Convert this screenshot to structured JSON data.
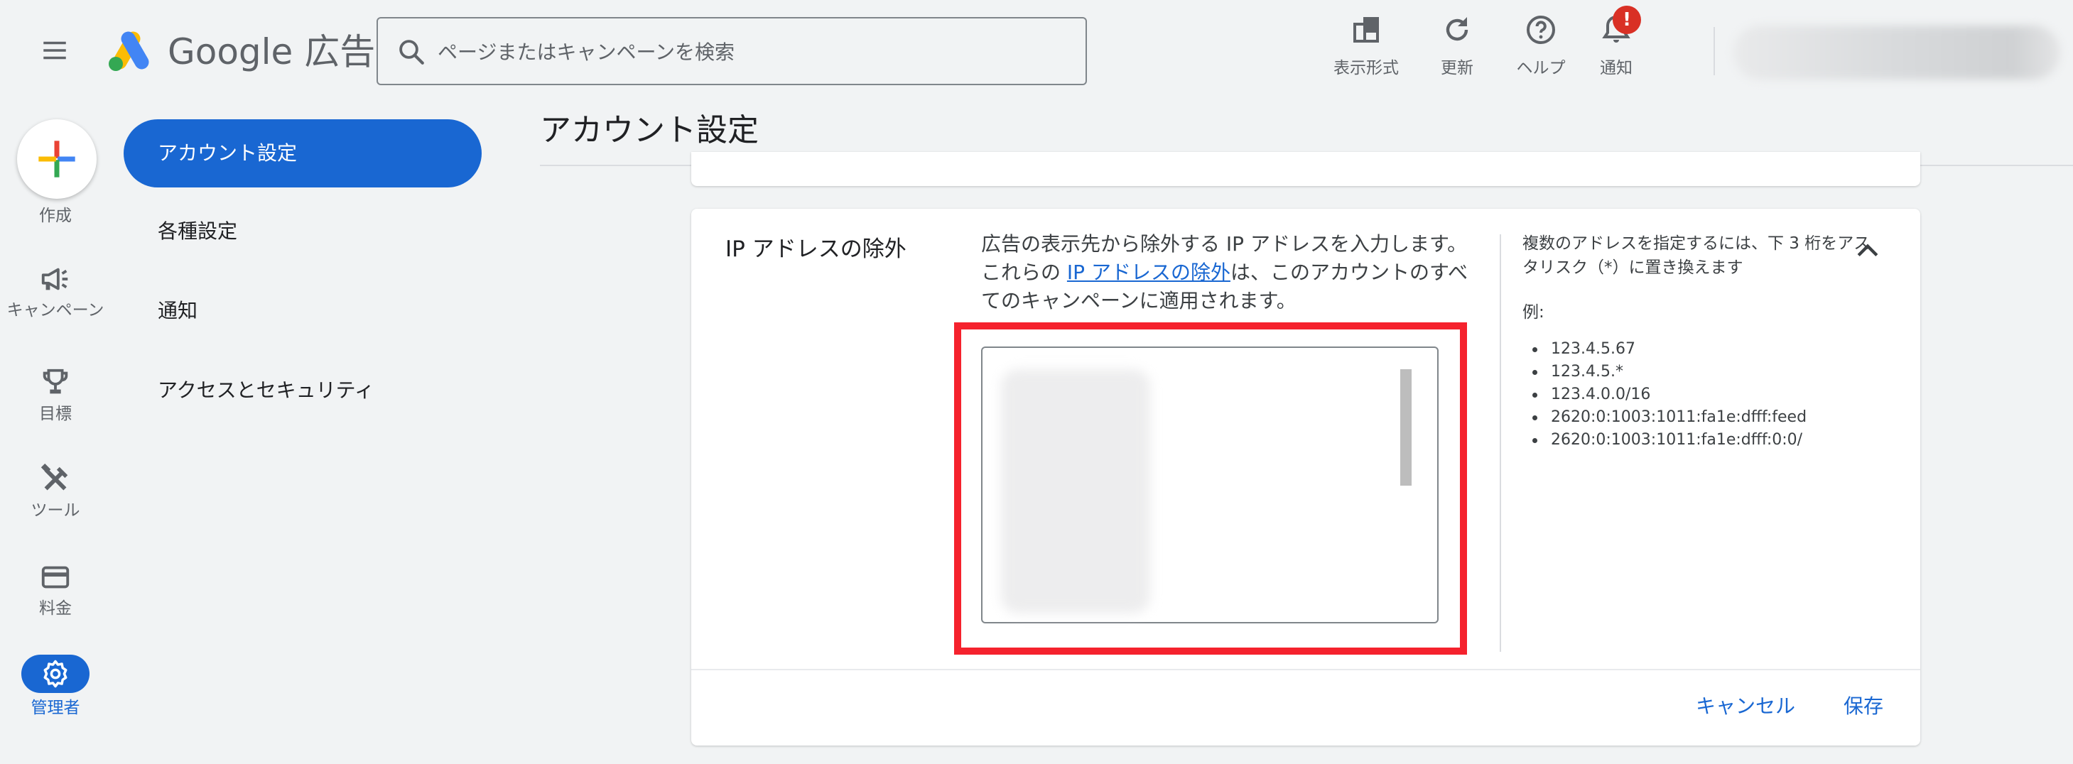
{
  "header": {
    "brand": "Google 広告",
    "search_placeholder": "ページまたはキャンペーンを検索",
    "actions": {
      "display_label": "表示形式",
      "refresh_label": "更新",
      "help_label": "ヘルプ",
      "notifications_label": "通知",
      "notifications_badge": "!"
    }
  },
  "rail": {
    "create_label": "作成",
    "campaigns_label": "キャンペーン",
    "goals_label": "目標",
    "tools_label": "ツール",
    "billing_label": "料金",
    "admin_label": "管理者"
  },
  "subnav": {
    "items": [
      {
        "label": "アカウント設定"
      },
      {
        "label": "各種設定"
      },
      {
        "label": "通知"
      },
      {
        "label": "アクセスとセキュリティ"
      }
    ]
  },
  "page": {
    "title": "アカウント設定"
  },
  "setting": {
    "title": "IP アドレスの除外",
    "desc_1": "広告の表示先から除外する IP アドレスを入力します。これらの ",
    "desc_link": "IP アドレスの除外",
    "desc_2": "は、このアカウントのすべてのキャンペーンに適用されます。",
    "help_text": "複数のアドレスを指定するには、下 3 桁をアスタリスク（*）に置き換えます",
    "help_example_label": "例:",
    "examples": [
      "123.4.5.67",
      "123.4.5.*",
      "123.4.0.0/16",
      "2620:0:1003:1011:fa1e:dfff:feed",
      "2620:0:1003:1011:fa1e:dfff:0:0/"
    ],
    "cancel_label": "キャンセル",
    "save_label": "保存"
  },
  "colors": {
    "primary": "#1967d2",
    "highlight": "#f5222d",
    "badge": "#d93025"
  }
}
